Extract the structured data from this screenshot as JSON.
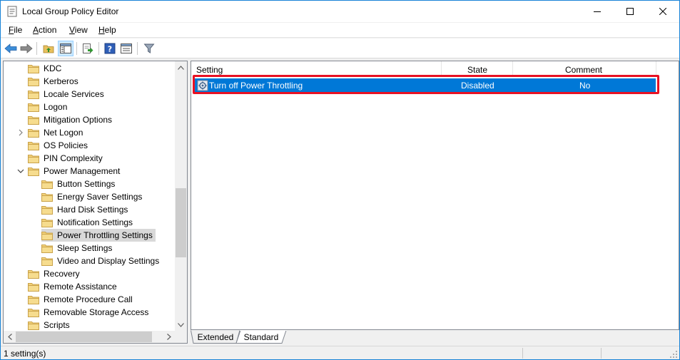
{
  "window": {
    "title": "Local Group Policy Editor"
  },
  "menu": {
    "items": [
      {
        "accel": "F",
        "rest": "ile"
      },
      {
        "accel": "A",
        "rest": "ction"
      },
      {
        "accel": "V",
        "rest": "iew"
      },
      {
        "accel": "H",
        "rest": "elp"
      }
    ]
  },
  "toolbar": {
    "icons": [
      "back-arrow-icon",
      "forward-arrow-icon",
      "up-folder-icon",
      "show-hide-tree-icon",
      "export-list-icon",
      "help-icon",
      "properties-icon",
      "filter-icon"
    ]
  },
  "tree": {
    "items": [
      {
        "label": "KDC"
      },
      {
        "label": "Kerberos"
      },
      {
        "label": "Locale Services"
      },
      {
        "label": "Logon"
      },
      {
        "label": "Mitigation Options"
      },
      {
        "label": "Net Logon"
      },
      {
        "label": "OS Policies"
      },
      {
        "label": "PIN Complexity"
      },
      {
        "label": "Power Management"
      },
      {
        "label": "Button Settings"
      },
      {
        "label": "Energy Saver Settings"
      },
      {
        "label": "Hard Disk Settings"
      },
      {
        "label": "Notification Settings"
      },
      {
        "label": "Power Throttling Settings"
      },
      {
        "label": "Sleep Settings"
      },
      {
        "label": "Video and Display Settings"
      },
      {
        "label": "Recovery"
      },
      {
        "label": "Remote Assistance"
      },
      {
        "label": "Remote Procedure Call"
      },
      {
        "label": "Removable Storage Access"
      },
      {
        "label": "Scripts"
      }
    ]
  },
  "list": {
    "columns": [
      "Setting",
      "State",
      "Comment"
    ],
    "rows": [
      {
        "setting": "Turn off Power Throttling",
        "state": "Disabled",
        "comment": "No"
      }
    ]
  },
  "tabs": [
    "Extended",
    "Standard"
  ],
  "status": {
    "text": "1 setting(s)"
  },
  "colors": {
    "selection": "#0078d7",
    "highlight_box": "#e81123",
    "folder": "#dcb65a"
  }
}
